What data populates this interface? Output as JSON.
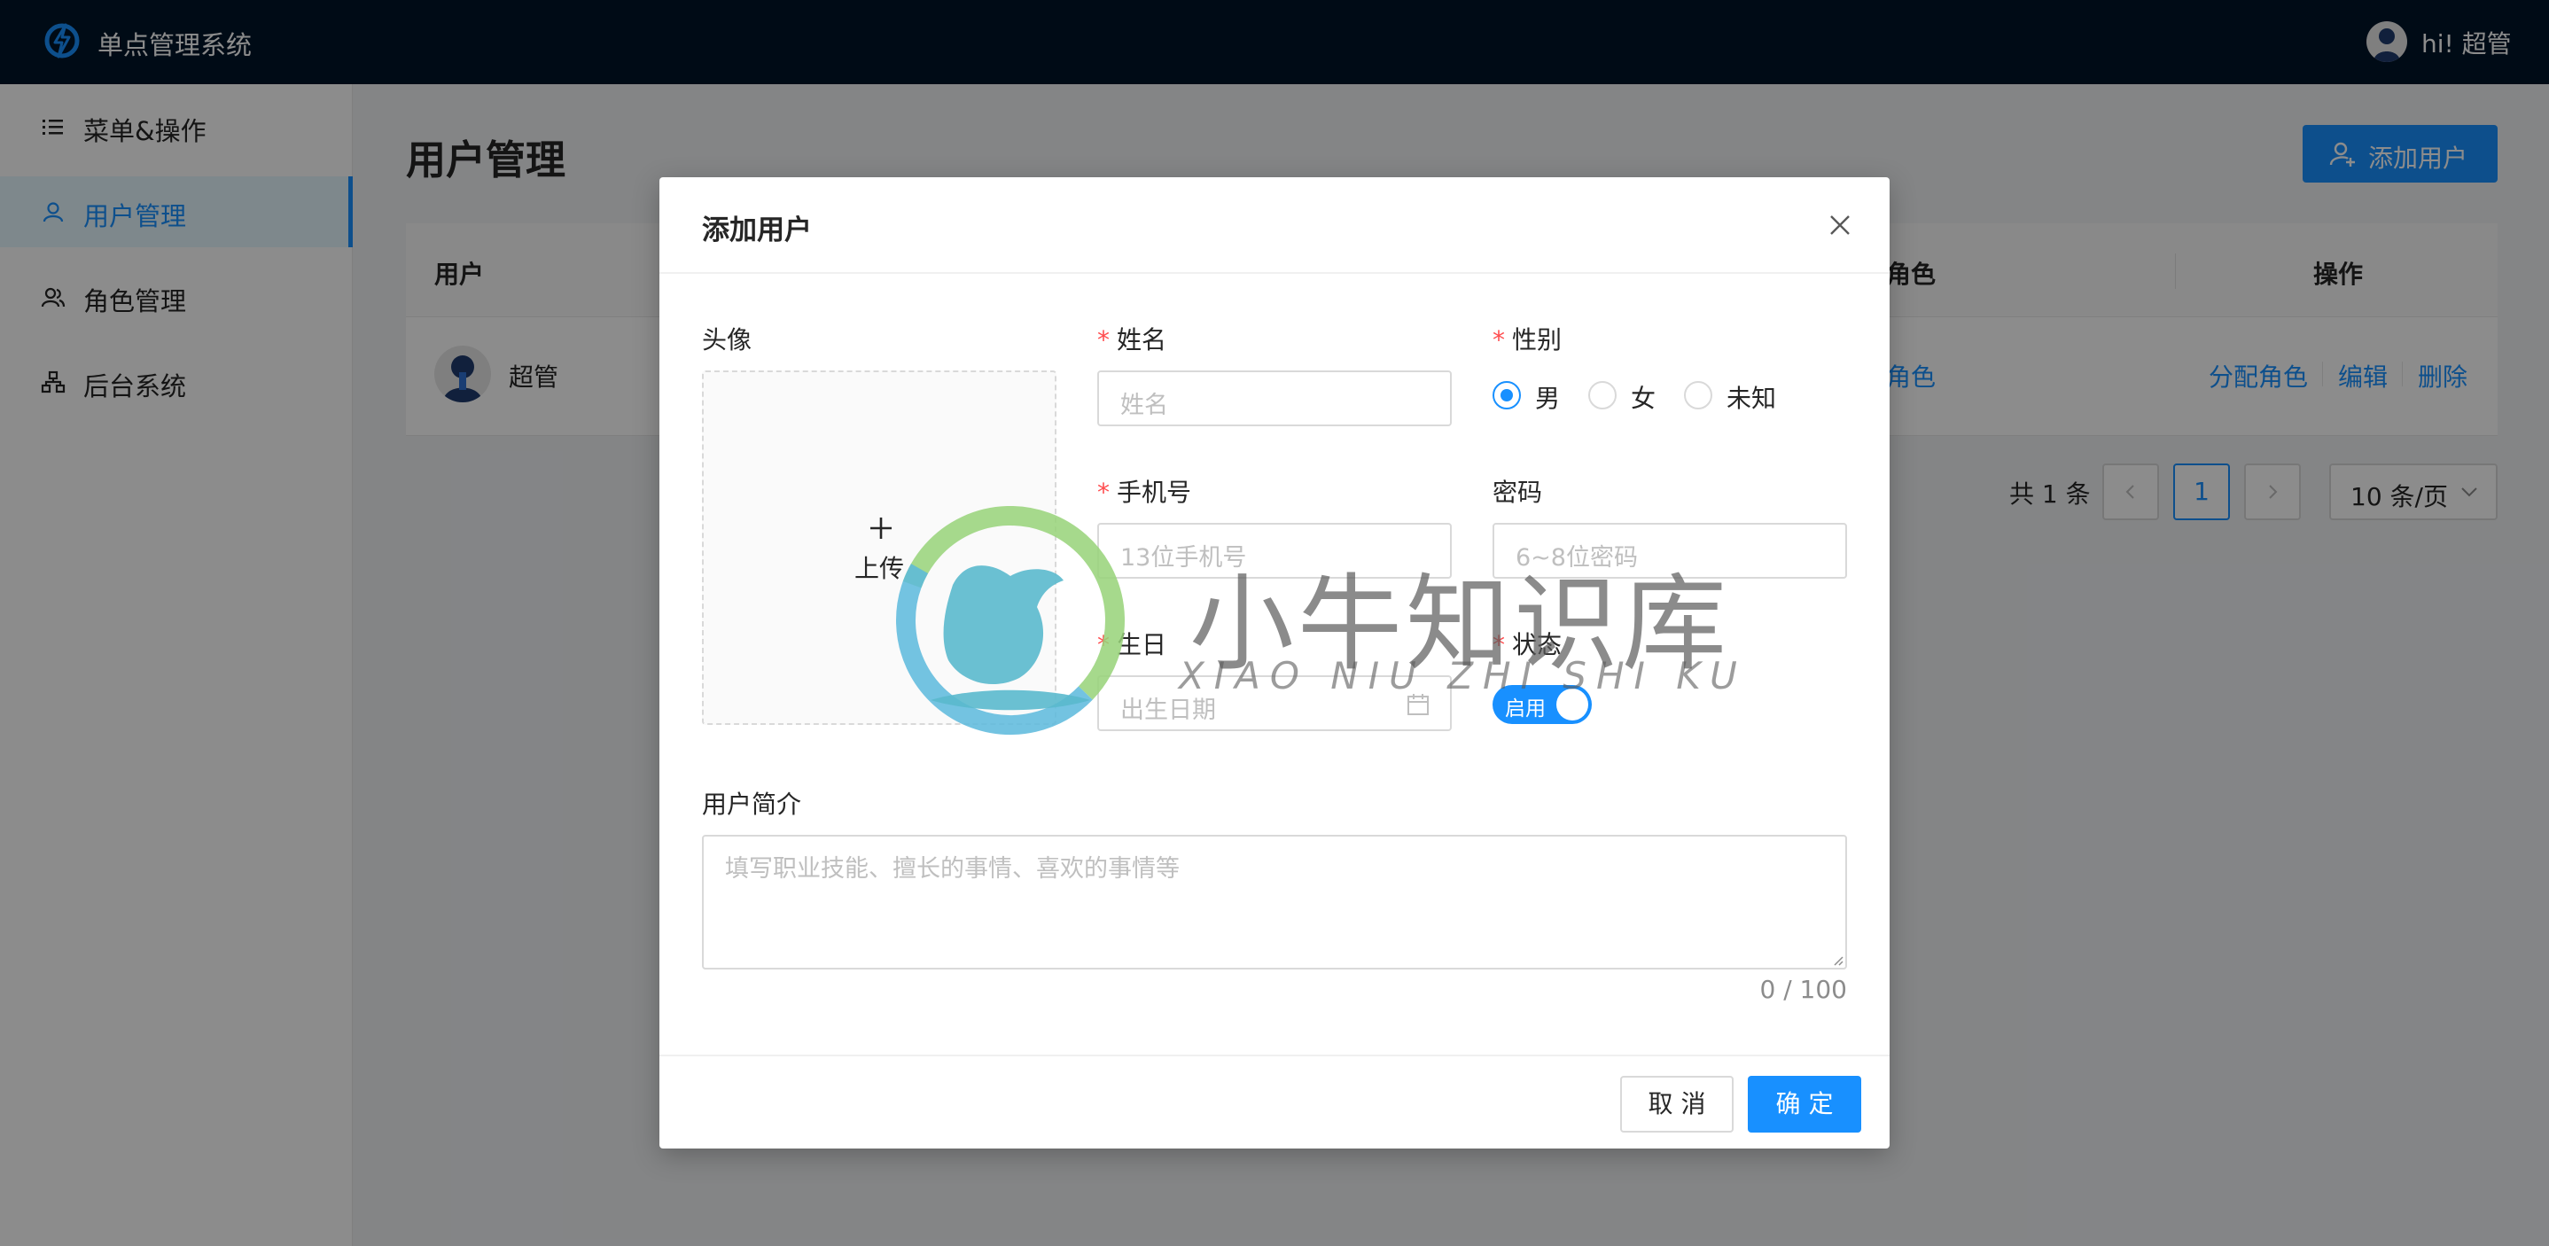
{
  "header": {
    "app_title": "单点管理系统",
    "greeting": "hi! 超管"
  },
  "sidebar": {
    "items": [
      {
        "label": "菜单&操作",
        "icon": "list-icon",
        "active": false
      },
      {
        "label": "用户管理",
        "icon": "user-icon",
        "active": true
      },
      {
        "label": "角色管理",
        "icon": "team-icon",
        "active": false
      },
      {
        "label": "后台系统",
        "icon": "cluster-icon",
        "active": false
      }
    ]
  },
  "main": {
    "page_title": "用户管理",
    "add_user_label": "添加用户",
    "table": {
      "columns": {
        "user": "用户",
        "role": "角色",
        "actions": "操作"
      },
      "rows": [
        {
          "user": "超管",
          "role": "角色",
          "actions": {
            "assign": "分配角色",
            "edit": "编辑",
            "delete": "删除"
          }
        }
      ]
    },
    "pagination": {
      "total_text": "共 1 条",
      "current_page": "1",
      "page_size": "10 条/页"
    }
  },
  "modal": {
    "title": "添加用户",
    "avatar_label": "头像",
    "upload_label": "上传",
    "name": {
      "label": "姓名",
      "placeholder": "姓名",
      "required": true
    },
    "gender": {
      "label": "性别",
      "required": true,
      "options": [
        "男",
        "女",
        "未知"
      ],
      "selected": "男"
    },
    "phone": {
      "label": "手机号",
      "placeholder": "13位手机号",
      "required": true
    },
    "password": {
      "label": "密码",
      "placeholder": "6~8位密码",
      "required": false
    },
    "birthday": {
      "label": "生日",
      "placeholder": "出生日期",
      "required": true
    },
    "status": {
      "label": "状态",
      "required": true,
      "switch_text": "启用",
      "on": true
    },
    "bio": {
      "label": "用户简介",
      "placeholder": "填写职业技能、擅长的事情、喜欢的事情等",
      "counter": "0 / 100"
    },
    "cancel_label": "取 消",
    "ok_label": "确 定"
  },
  "watermark": {
    "text": "小牛知识库",
    "pinyin": "XIAO NIU ZHI SHI KU"
  },
  "colors": {
    "primary": "#1890ff",
    "header_bg": "#001529",
    "required": "#ff4d4f"
  }
}
